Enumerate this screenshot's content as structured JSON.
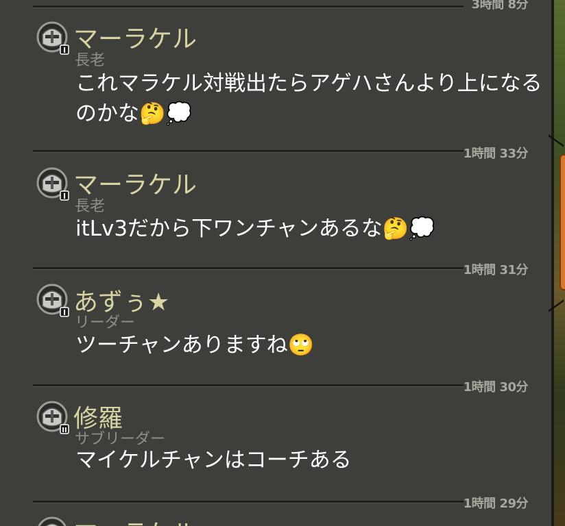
{
  "chat": {
    "top_partial_time": "3時間 8分",
    "messages": [
      {
        "name": "マーラケル",
        "role": "長老",
        "text": "これマラケル対戦出たらアゲハさんより上になるのかな🤔💭",
        "time_after": "1時間 33分",
        "rank_badge": "I"
      },
      {
        "name": "マーラケル",
        "role": "長老",
        "text": "itLv3だから下ワンチャンあるな🤔💭",
        "time_after": "1時間 31分",
        "rank_badge": "I"
      },
      {
        "name": "あずぅ★",
        "role": "リーダー",
        "text": "ツーチャンありますね🙄",
        "time_after": "1時間 30分",
        "rank_badge": "I"
      },
      {
        "name": "修羅",
        "role": "サブリーダー",
        "text": "マイケルチャンはコーチある",
        "time_after": "1時間 29分",
        "rank_badge": "II"
      }
    ],
    "bottom_partial_name": "マーラケル"
  },
  "colors": {
    "background": "#3e3e3a",
    "name": "#d8d3a3",
    "role": "#8f8f88",
    "text": "#ffffff",
    "time": "#a8a8a0",
    "side_tab": "#d9772a"
  },
  "icons": {
    "avatar": "helmet-icon"
  }
}
